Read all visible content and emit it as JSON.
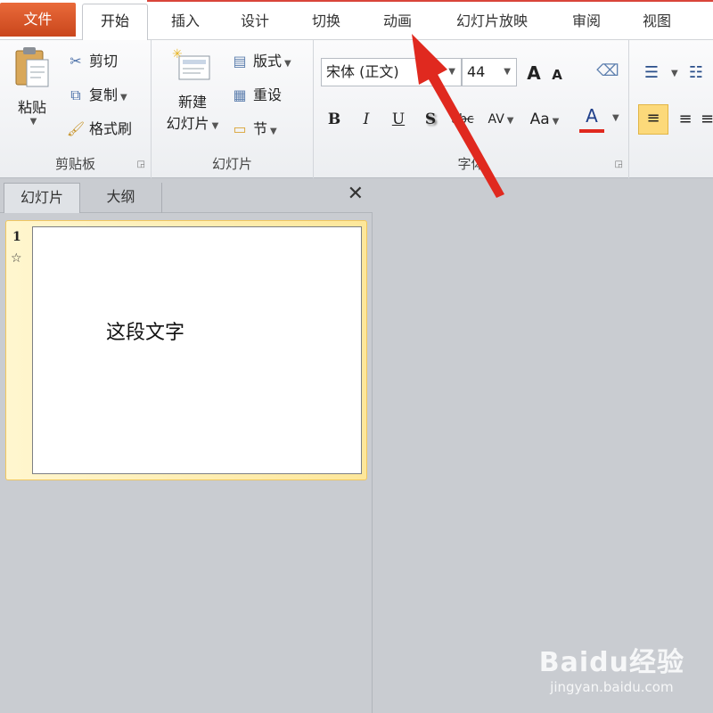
{
  "tabs": {
    "file": "文件",
    "home": "开始",
    "items": [
      "插入",
      "设计",
      "切换",
      "动画",
      "幻灯片放映",
      "审阅",
      "视图"
    ]
  },
  "clipboard": {
    "paste": "粘贴",
    "cut": "剪切",
    "copy": "复制",
    "format_painter": "格式刷",
    "label": "剪贴板"
  },
  "slides_group": {
    "new_slide_line1": "新建",
    "new_slide_line2": "幻灯片",
    "layout": "版式",
    "reset": "重设",
    "section": "节",
    "label": "幻灯片"
  },
  "font_group": {
    "font_name": "宋体 (正文)",
    "font_size": "44",
    "grow": "A",
    "shrink": "A",
    "bold": "B",
    "italic": "I",
    "underline": "U",
    "shadow": "S",
    "strike": "abc",
    "spacing": "AV",
    "case": "Aa",
    "color": "A",
    "label": "字体"
  },
  "pane": {
    "tab_slides": "幻灯片",
    "tab_outline": "大纲",
    "close": "✕"
  },
  "thumbnail": {
    "number": "1",
    "star": "☆",
    "text": "这段文字"
  },
  "watermark": {
    "brand": "Baidu经验",
    "url": "jingyan.baidu.com"
  },
  "colors": {
    "accent_red": "#e0291f",
    "file_tab": "#d4552a"
  }
}
